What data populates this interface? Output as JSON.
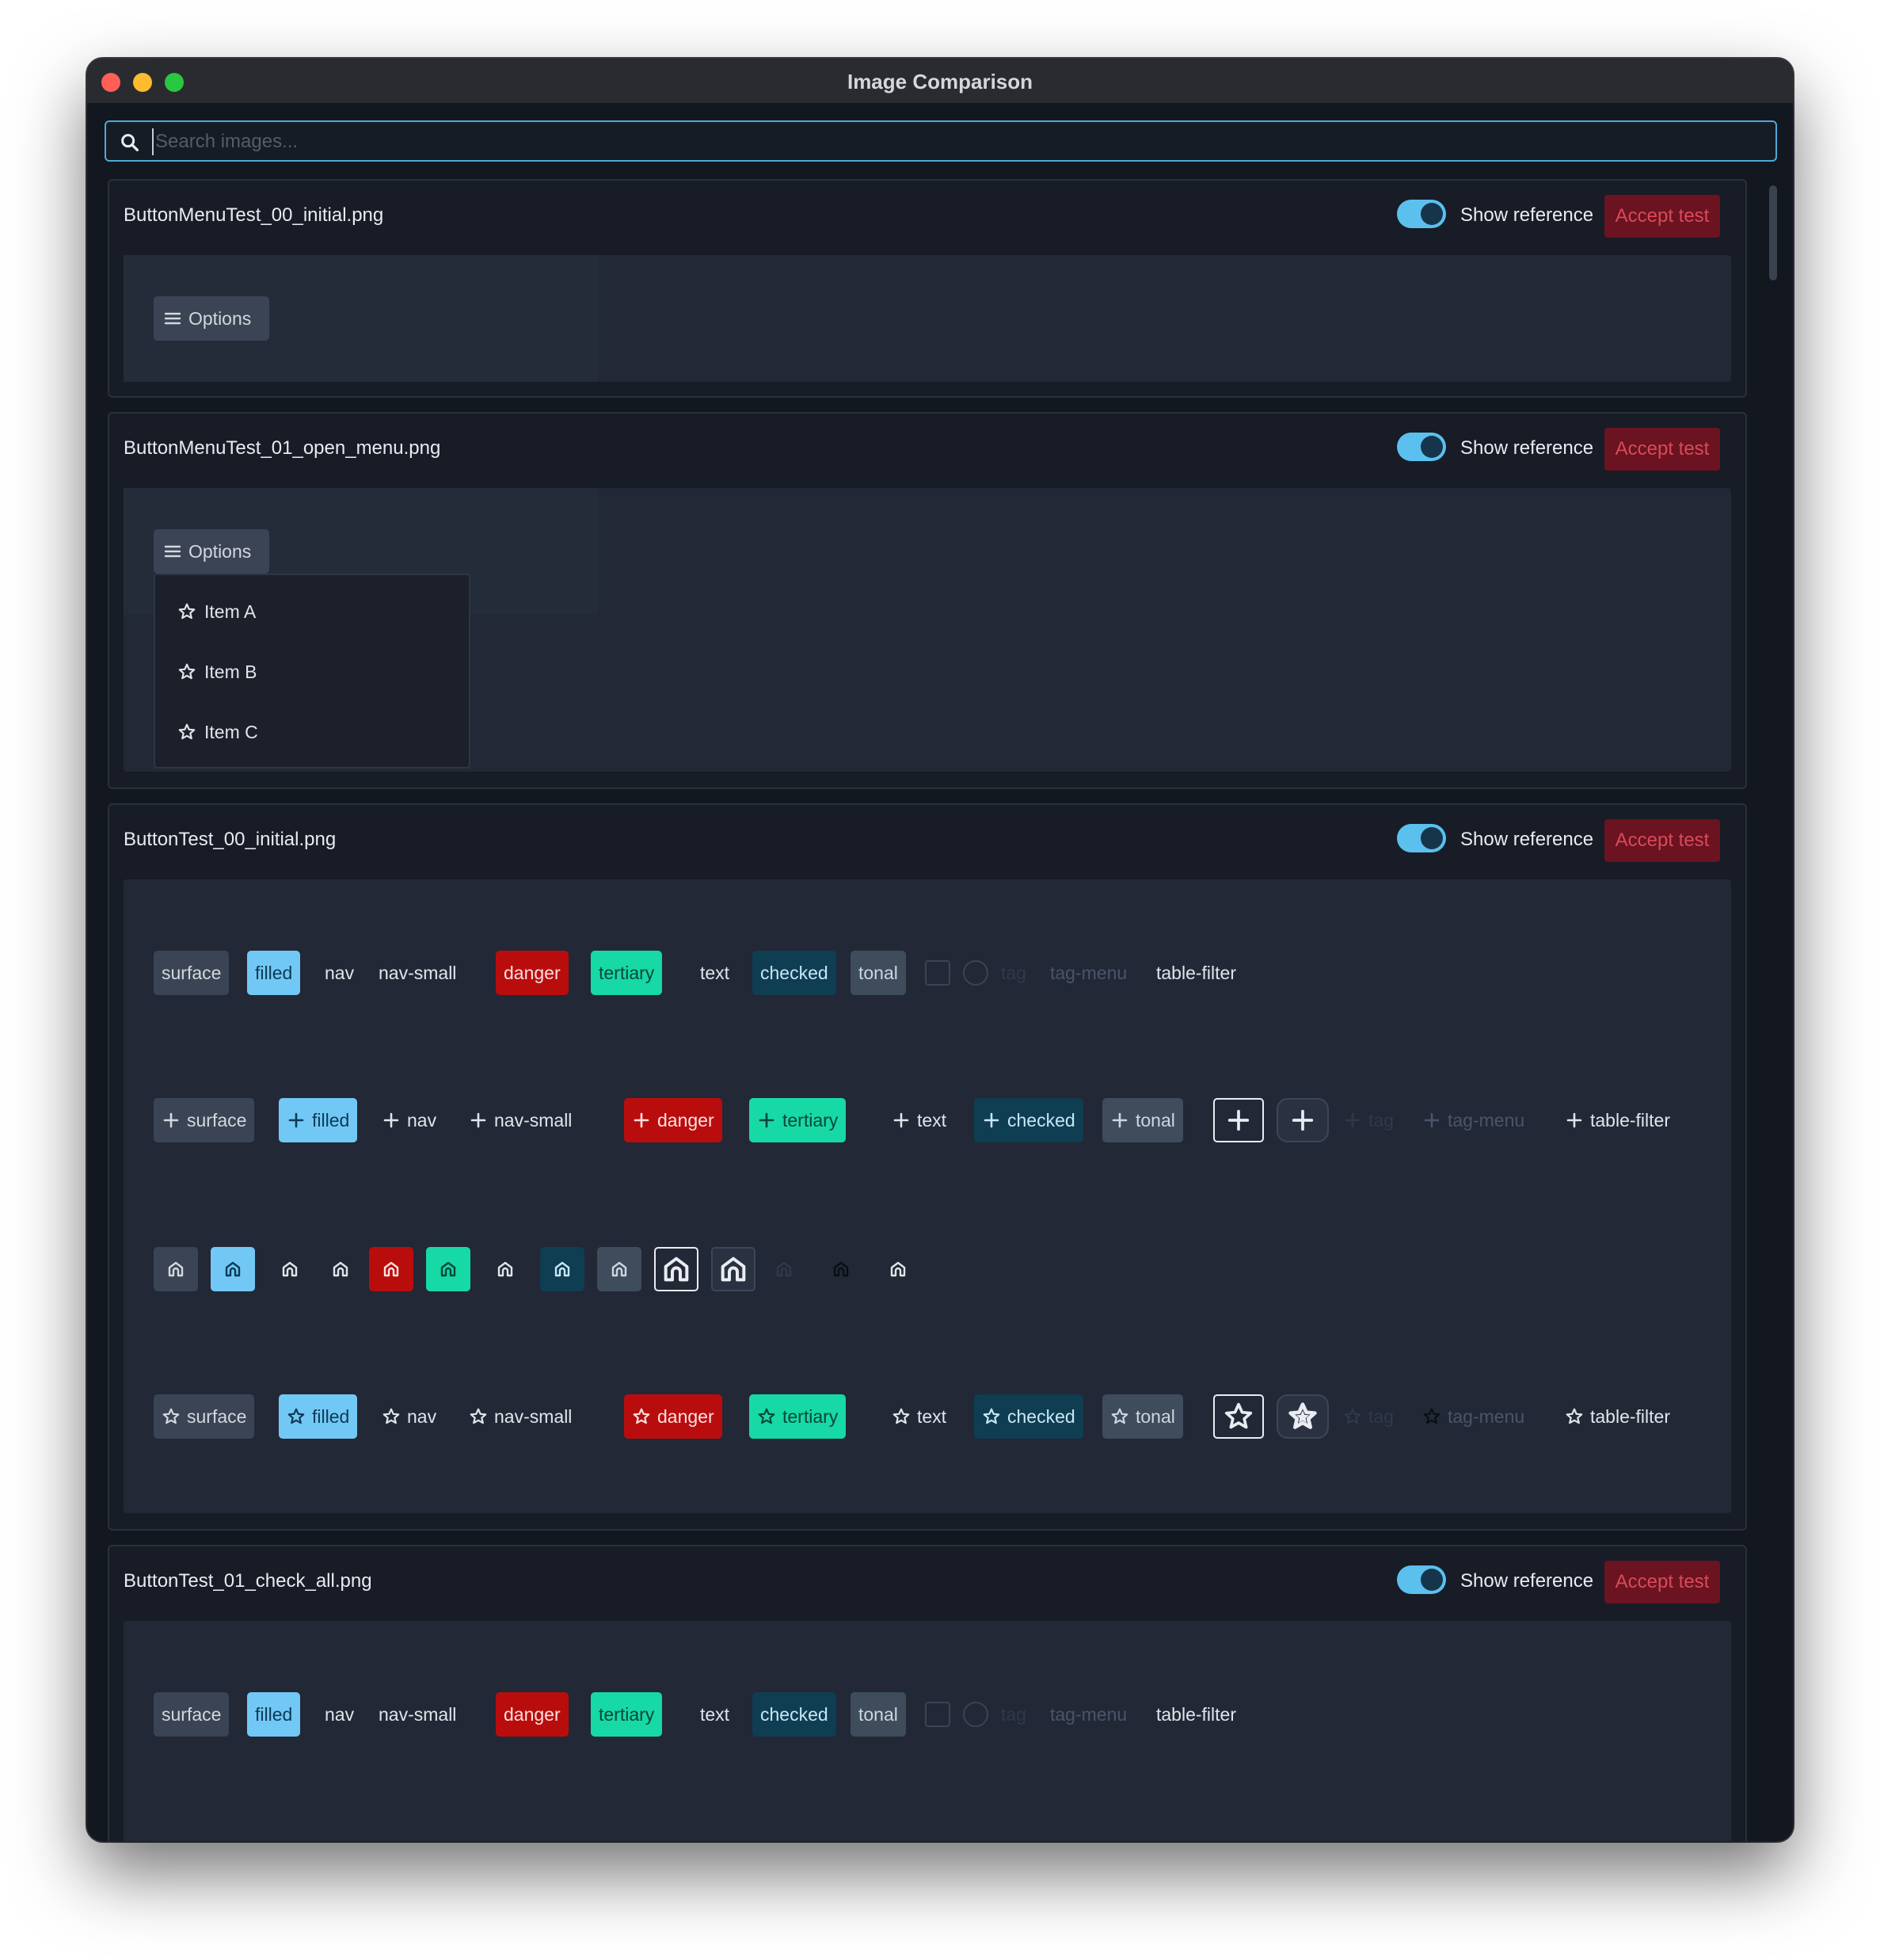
{
  "window": {
    "title": "Image Comparison"
  },
  "search": {
    "placeholder": "Search images..."
  },
  "icons": {
    "search": "search-icon",
    "menu": "hamburger-icon",
    "plus": "plus-icon",
    "star": "star-icon",
    "house": "house-icon"
  },
  "colors": {
    "accent": "#5bc0ee",
    "accept_bg": "#6b1320",
    "accept_text": "#d84a5a",
    "danger": "#b90d0d",
    "tertiary": "#16d9a6",
    "filled": "#72c8f4"
  },
  "cards": [
    {
      "filename": "ButtonMenuTest_00_initial.png",
      "show_reference": "Show reference",
      "show_reference_on": true,
      "accept": "Accept test",
      "options_label": "Options"
    },
    {
      "filename": "ButtonMenuTest_01_open_menu.png",
      "show_reference": "Show reference",
      "show_reference_on": true,
      "accept": "Accept test",
      "options_label": "Options",
      "menu_items": [
        "Item A",
        "Item B",
        "Item C"
      ]
    },
    {
      "filename": "ButtonTest_00_initial.png",
      "show_reference": "Show reference",
      "show_reference_on": true,
      "accept": "Accept test",
      "button_labels": [
        "surface",
        "filled",
        "nav",
        "nav-small",
        "danger",
        "tertiary",
        "text",
        "checked",
        "tonal",
        "tag",
        "tag-menu",
        "table-filter"
      ]
    },
    {
      "filename": "ButtonTest_01_check_all.png",
      "show_reference": "Show reference",
      "show_reference_on": true,
      "accept": "Accept test",
      "button_labels": [
        "surface",
        "filled",
        "nav",
        "nav-small",
        "danger",
        "tertiary",
        "text",
        "checked",
        "tonal",
        "tag",
        "tag-menu",
        "table-filter"
      ]
    }
  ]
}
